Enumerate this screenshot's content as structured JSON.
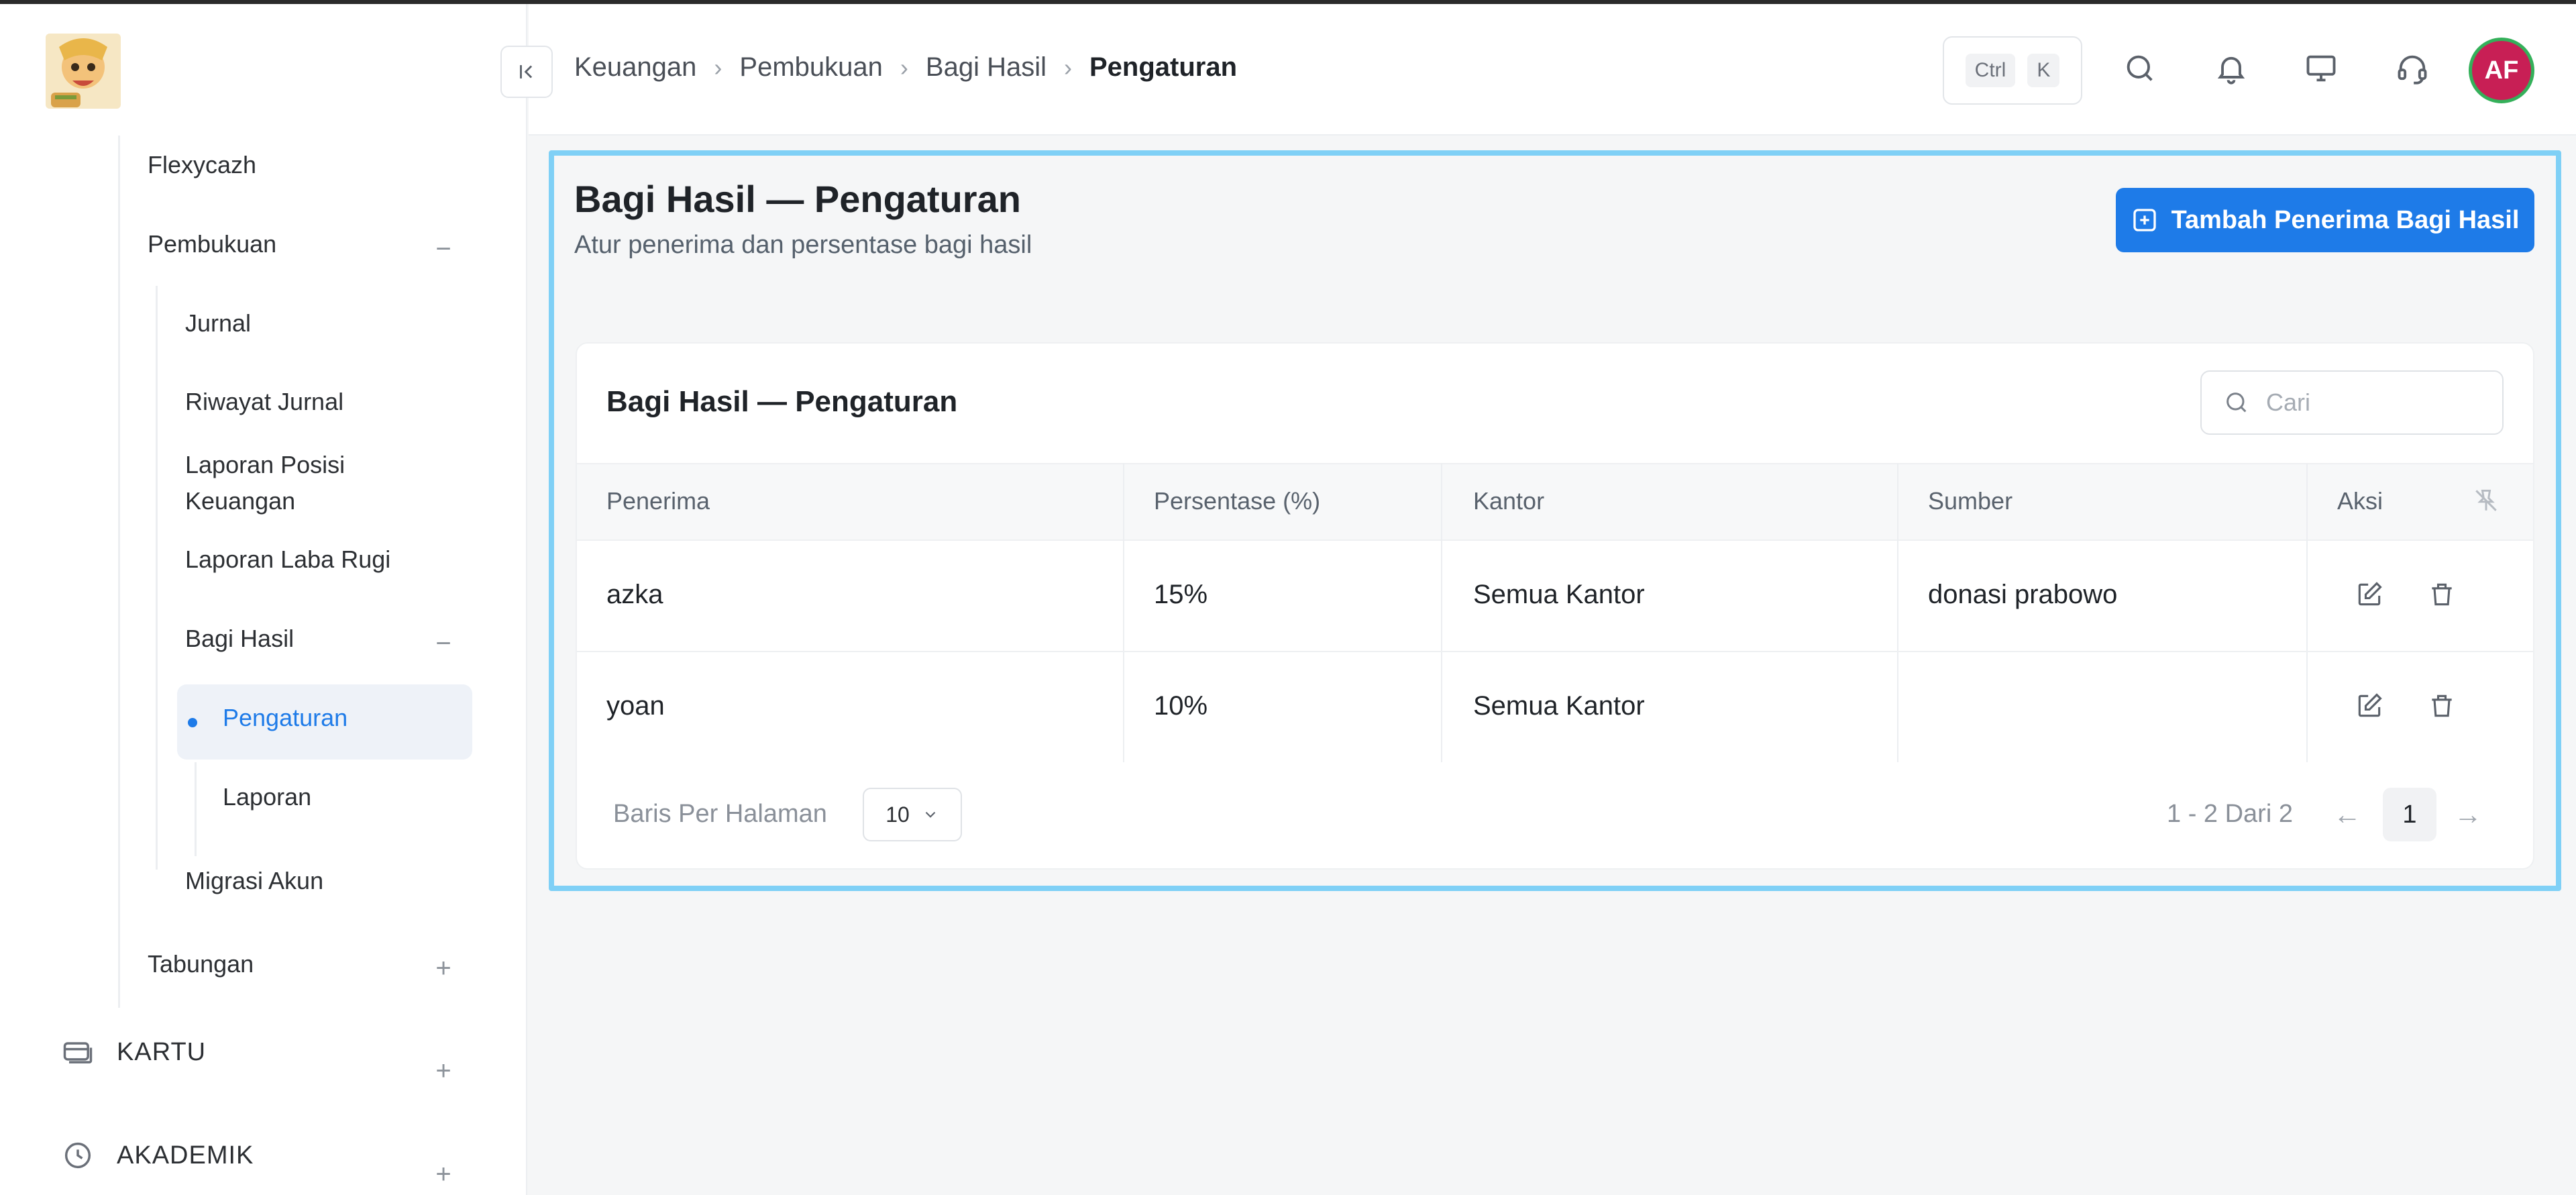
{
  "sidebar": {
    "items": [
      {
        "label": "Flexycazh"
      },
      {
        "label": "Pembukuan"
      },
      {
        "label": "Jurnal"
      },
      {
        "label": "Riwayat Jurnal"
      },
      {
        "label": "Laporan Posisi Keuangan"
      },
      {
        "label": "Laporan Laba Rugi"
      },
      {
        "label": "Bagi Hasil"
      },
      {
        "label": "Pengaturan"
      },
      {
        "label": "Laporan"
      },
      {
        "label": "Migrasi Akun"
      },
      {
        "label": "Tabungan"
      }
    ],
    "sections": [
      {
        "label": "KARTU"
      },
      {
        "label": "AKADEMIK"
      }
    ],
    "active_color": "#1e7be8"
  },
  "header": {
    "breadcrumb": [
      "Keuangan",
      "Pembukuan",
      "Bagi Hasil",
      "Pengaturan"
    ],
    "shortcut": {
      "key1": "Ctrl",
      "key2": "K"
    },
    "icons": [
      "search-icon",
      "bell-icon",
      "monitor-icon",
      "headset-icon"
    ],
    "avatar_initials": "AF"
  },
  "page": {
    "title": "Bagi Hasil — Pengaturan",
    "subtitle": "Atur penerima dan persentase bagi hasil",
    "add_button": "Tambah Penerima Bagi Hasil"
  },
  "table": {
    "title": "Bagi Hasil — Pengaturan",
    "search_placeholder": "Cari",
    "columns": [
      "Penerima",
      "Persentase (%)",
      "Kantor",
      "Sumber",
      "Aksi"
    ],
    "rows": [
      {
        "penerima": "azka",
        "persentase": "15%",
        "kantor": "Semua Kantor",
        "sumber": "donasi prabowo"
      },
      {
        "penerima": "yoan",
        "persentase": "10%",
        "kantor": "Semua Kantor",
        "sumber": ""
      }
    ]
  },
  "pagination": {
    "rows_per_page_label": "Baris Per Halaman",
    "rows_per_page": "10",
    "range": "1 - 2 Dari 2",
    "prev": "←",
    "next": "→",
    "current_page": "1"
  },
  "colors": {
    "primary": "#1e7be8",
    "avatar_bg": "#c81f55",
    "avatar_ring": "#34b05a",
    "focus_frame": "#7fd0f6"
  }
}
